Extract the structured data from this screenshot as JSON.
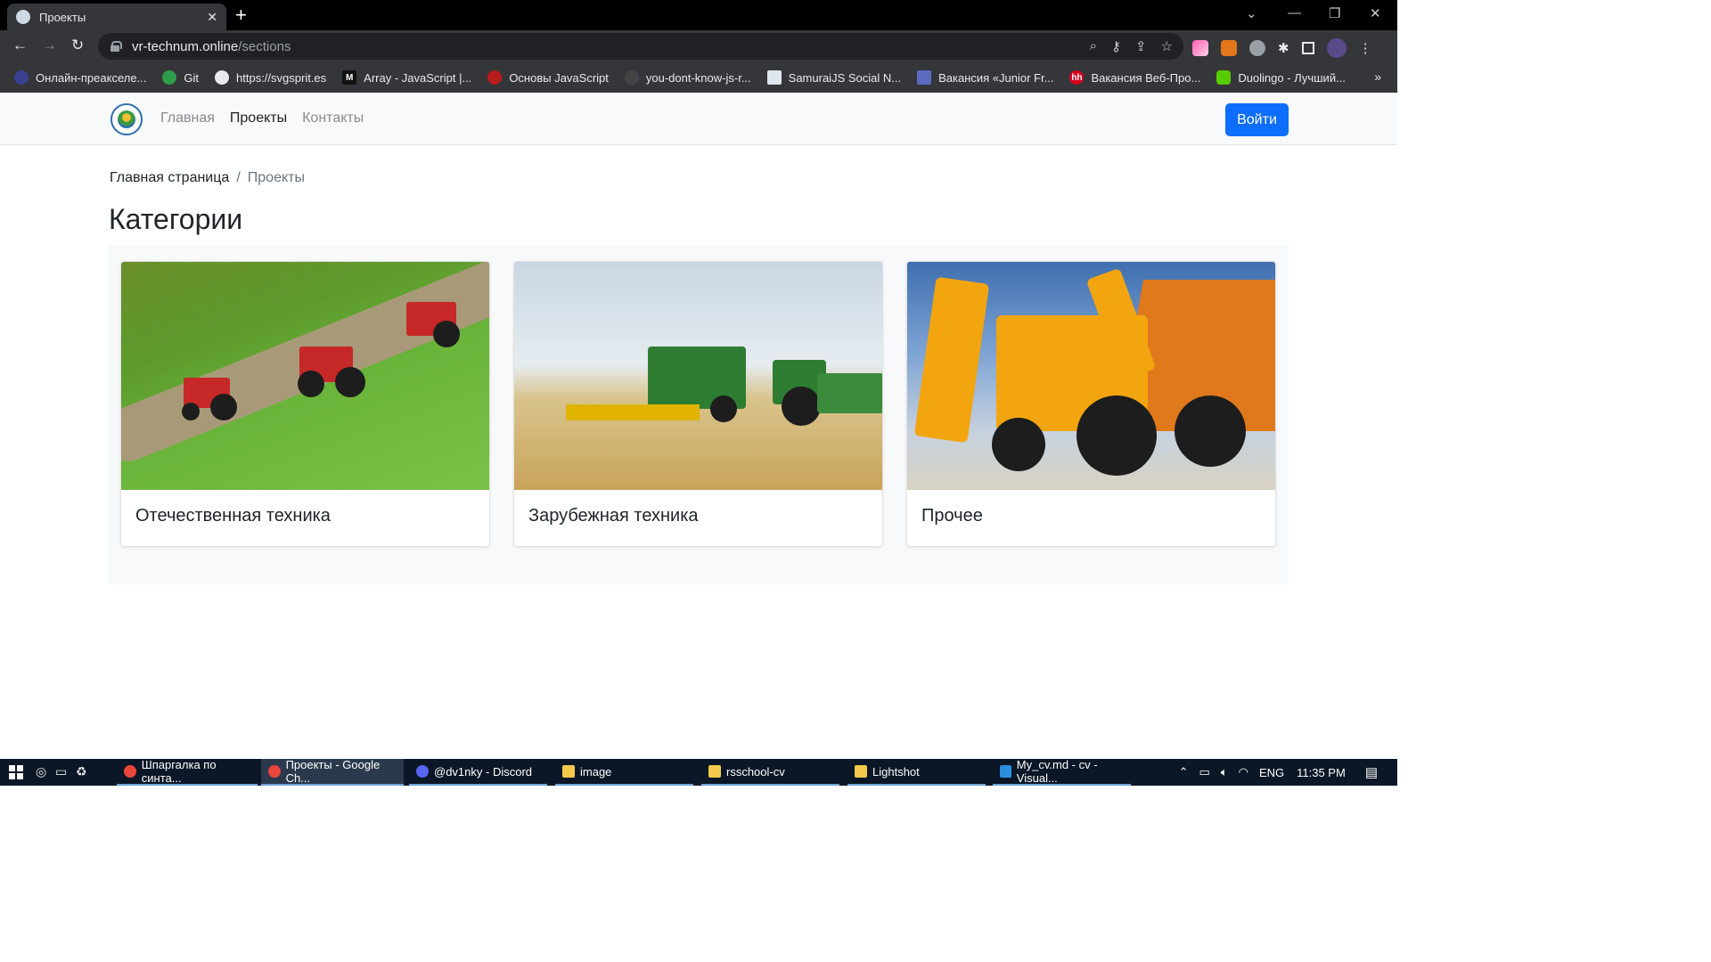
{
  "browser": {
    "tab_title": "Проекты",
    "tab_close": "✕",
    "new_tab": "+",
    "url_host": "vr-technum.online",
    "url_path": "/sections",
    "bookmarks": [
      "Онлайн-преакселе...",
      "Git",
      "https://svgsprit.es",
      "Array - JavaScript |...",
      "Основы JavaScript",
      "you-dont-know-js-r...",
      "SamuraiJS Social N...",
      "Вакансия «Junior Fr...",
      "Вакансия Веб-Про...",
      "Duolingo - Лучший..."
    ],
    "bookmarks_more": "»"
  },
  "nav": {
    "items": [
      "Главная",
      "Проекты",
      "Контакты"
    ],
    "login": "Войти"
  },
  "breadcrumb": {
    "home": "Главная страница",
    "separator": "/",
    "current": "Проекты"
  },
  "page": {
    "title": "Категории",
    "cards": [
      {
        "title": "Отечественная техника"
      },
      {
        "title": "Зарубежная техника"
      },
      {
        "title": "Прочее"
      }
    ]
  },
  "taskbar": {
    "tasks": [
      "Шпаргалка по синта...",
      "Проекты - Google Ch...",
      "@dv1nky - Discord",
      "image",
      "rsschool-cv",
      "Lightshot",
      "My_cv.md - cv - Visual..."
    ],
    "lang": "ENG",
    "time": "11:35 PM"
  },
  "colors": {
    "accent": "#0d6efd",
    "nav_bg": "#f8f9fa"
  }
}
